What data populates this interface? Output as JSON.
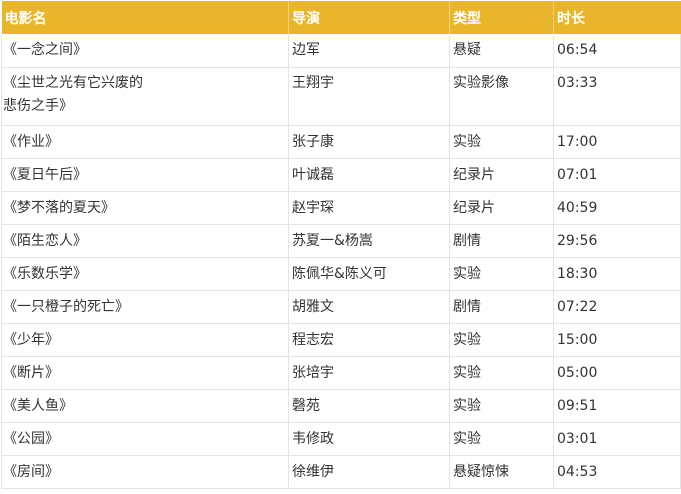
{
  "headers": {
    "title": "电影名",
    "director": "导演",
    "genre": "类型",
    "duration": "时长"
  },
  "rows": [
    {
      "title": "《一念之间》",
      "director": "边军",
      "genre": "悬疑",
      "duration": "06:54"
    },
    {
      "title": "《尘世之光有它兴废的\n悲伤之手》",
      "director": "王翔宇",
      "genre": "实验影像",
      "duration": "03:33"
    },
    {
      "title": "《作业》",
      "director": "张子康",
      "genre": "实验",
      "duration": "17:00"
    },
    {
      "title": "《夏日午后》",
      "director": "叶诚磊",
      "genre": "纪录片",
      "duration": "07:01"
    },
    {
      "title": "《梦不落的夏天》",
      "director": "赵宇琛",
      "genre": "纪录片",
      "duration": "40:59"
    },
    {
      "title": "《陌生恋人》",
      "director": "苏夏一&杨嵩",
      "genre": "剧情",
      "duration": "29:56"
    },
    {
      "title": "《乐数乐学》",
      "director": "陈佩华&陈义可",
      "genre": "实验",
      "duration": "18:30"
    },
    {
      "title": "《一只橙子的死亡》",
      "director": "胡雅文",
      "genre": "剧情",
      "duration": "07:22"
    },
    {
      "title": "《少年》",
      "director": "程志宏",
      "genre": "实验",
      "duration": "15:00"
    },
    {
      "title": "《断片》",
      "director": "张培宇",
      "genre": "实验",
      "duration": "05:00"
    },
    {
      "title": "《美人鱼》",
      "director": "磬苑",
      "genre": "实验",
      "duration": "09:51"
    },
    {
      "title": "《公园》",
      "director": "韦修政",
      "genre": "实验",
      "duration": "03:01"
    },
    {
      "title": "《房间》",
      "director": "徐维伊",
      "genre": "悬疑惊悚",
      "duration": "04:53"
    }
  ],
  "colors": {
    "header_bg": "#e9b52a",
    "header_text": "#ffffff",
    "border": "#e4e4e4",
    "cell_text": "#333333"
  }
}
